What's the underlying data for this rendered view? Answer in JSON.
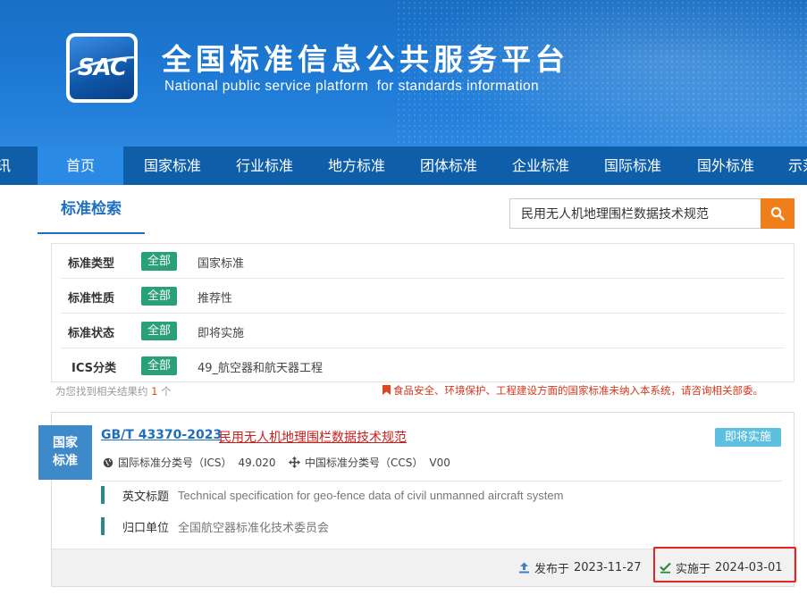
{
  "header": {
    "logo_text": "SAC",
    "title": "全国标准信息公共服务平台",
    "subtitle": "National public service platform  for standards information"
  },
  "nav": {
    "items": [
      {
        "label": "首页",
        "active": true
      },
      {
        "label": "国家标准"
      },
      {
        "label": "行业标准"
      },
      {
        "label": "地方标准"
      },
      {
        "label": "团体标准"
      },
      {
        "label": "企业标准"
      },
      {
        "label": "国际标准"
      },
      {
        "label": "国外标准"
      },
      {
        "label": "示范"
      }
    ]
  },
  "search": {
    "tab_label": "标准检索",
    "query": "民用无人机地理围栏数据技术规范",
    "button_icon": "search-icon"
  },
  "filters": [
    {
      "label": "标准类型",
      "all": "全部",
      "value": "国家标准"
    },
    {
      "label": "标准性质",
      "all": "全部",
      "value": "推荐性"
    },
    {
      "label": "标准状态",
      "all": "全部",
      "value": "即将实施"
    },
    {
      "label": "ICS分类",
      "all": "全部",
      "value": "49_航空器和航天器工程"
    }
  ],
  "results_summary": {
    "prefix": "为您找到相关结果约",
    "count": "1",
    "suffix": "个",
    "notice": "食品安全、环境保护、工程建设方面的国家标准未纳入本系统，请咨询相关部委。"
  },
  "result": {
    "badge": [
      "国家",
      "标准"
    ],
    "std_no": "GB/T 43370-2023",
    "std_name": "民用无人机地理围栏数据技术规范",
    "status": "即将实施",
    "ics_label": "国际标准分类号（ICS）",
    "ics_value": "49.020",
    "ccs_label": "中国标准分类号（CCS）",
    "ccs_value": "V00",
    "en_title_label": "英文标题",
    "en_title": "Technical specification for geo-fence data of civil unmanned aircraft system",
    "dept_label": "归口单位",
    "dept": "全国航空器标准化技术委员会",
    "published_label": "发布于",
    "published": "2023-11-27",
    "implemented_label": "实施于",
    "implemented": "2024-03-01"
  },
  "colors": {
    "nav_bg": "#0f5ea9",
    "nav_active": "#2b8ae6",
    "accent_blue": "#1d6fbe",
    "tag_green": "#2aa07a",
    "search_orange": "#f07e1a",
    "status_tag": "#5cc0de",
    "highlight_red": "#e0261f"
  }
}
